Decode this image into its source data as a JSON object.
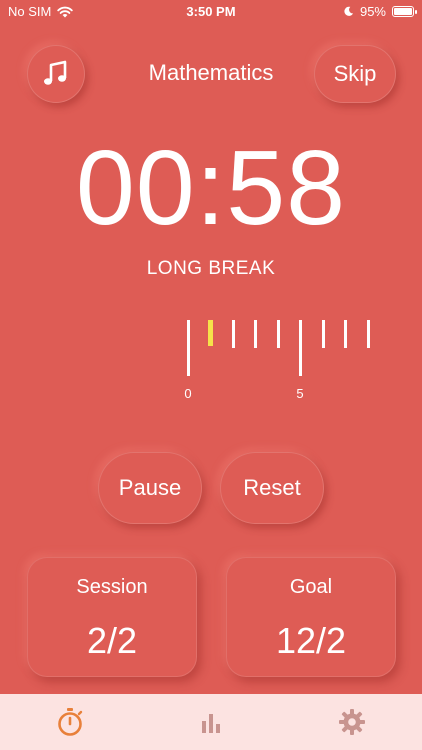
{
  "status_bar": {
    "carrier": "No SIM",
    "time": "3:50 PM",
    "battery": "95%"
  },
  "header": {
    "subject": "Mathematics",
    "skip_label": "Skip"
  },
  "timer": {
    "display": "00:58",
    "phase": "LONG BREAK"
  },
  "progress_ruler": {
    "label_start": "0",
    "label_mid": "5",
    "current_position": 1,
    "tick_count": 9
  },
  "controls": {
    "pause_label": "Pause",
    "reset_label": "Reset"
  },
  "stats": {
    "session": {
      "label": "Session",
      "value": "2/2"
    },
    "goal": {
      "label": "Goal",
      "value": "12/2"
    }
  },
  "tabs": [
    {
      "icon": "stopwatch-icon",
      "active": true
    },
    {
      "icon": "bar-chart-icon",
      "active": false
    },
    {
      "icon": "gear-icon",
      "active": false
    }
  ],
  "colors": {
    "background": "#DE5C55",
    "tabbar": "#FCE3E1",
    "active_tab": "#E8803A",
    "inactive_tab": "#C8948F",
    "progress_marker": "#F6E24A"
  }
}
